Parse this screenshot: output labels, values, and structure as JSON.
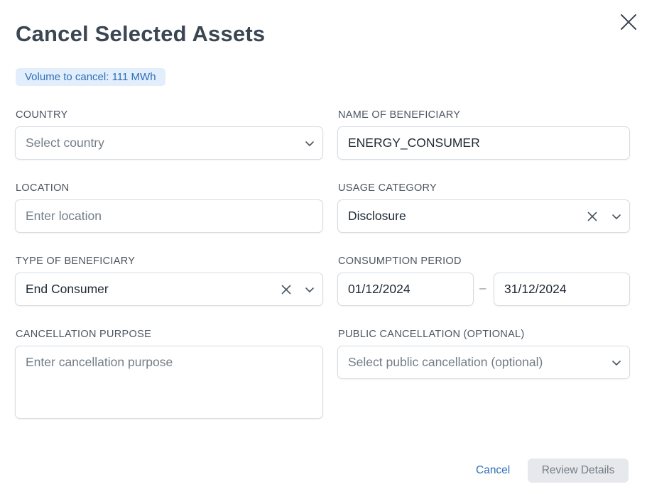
{
  "dialog": {
    "title": "Cancel Selected Assets",
    "volume_badge": "Volume to cancel: 111 MWh"
  },
  "fields": {
    "country": {
      "label": "COUNTRY",
      "placeholder": "Select country",
      "value": ""
    },
    "beneficiary_name": {
      "label": "NAME OF BENEFICIARY",
      "value": "ENERGY_CONSUMER"
    },
    "location": {
      "label": "LOCATION",
      "placeholder": "Enter location",
      "value": ""
    },
    "usage_category": {
      "label": "USAGE CATEGORY",
      "value": "Disclosure"
    },
    "beneficiary_type": {
      "label": "TYPE OF BENEFICIARY",
      "value": "End Consumer"
    },
    "consumption_period": {
      "label": "CONSUMPTION PERIOD",
      "start": "01/12/2024",
      "end": "31/12/2024",
      "separator": "–"
    },
    "cancellation_purpose": {
      "label": "CANCELLATION PURPOSE",
      "placeholder": "Enter cancellation purpose",
      "value": ""
    },
    "public_cancellation": {
      "label": "PUBLIC CANCELLATION (OPTIONAL)",
      "placeholder": "Select public cancellation (optional)",
      "value": ""
    }
  },
  "footer": {
    "cancel_label": "Cancel",
    "review_label": "Review Details"
  },
  "icons": {
    "close": "close-icon",
    "chevron": "chevron-down-icon",
    "clear": "clear-icon"
  },
  "colors": {
    "accent": "#2f6fb8",
    "badge_bg": "#e2eefb",
    "title": "#3a4652",
    "disabled_bg": "#e6e8eb"
  }
}
